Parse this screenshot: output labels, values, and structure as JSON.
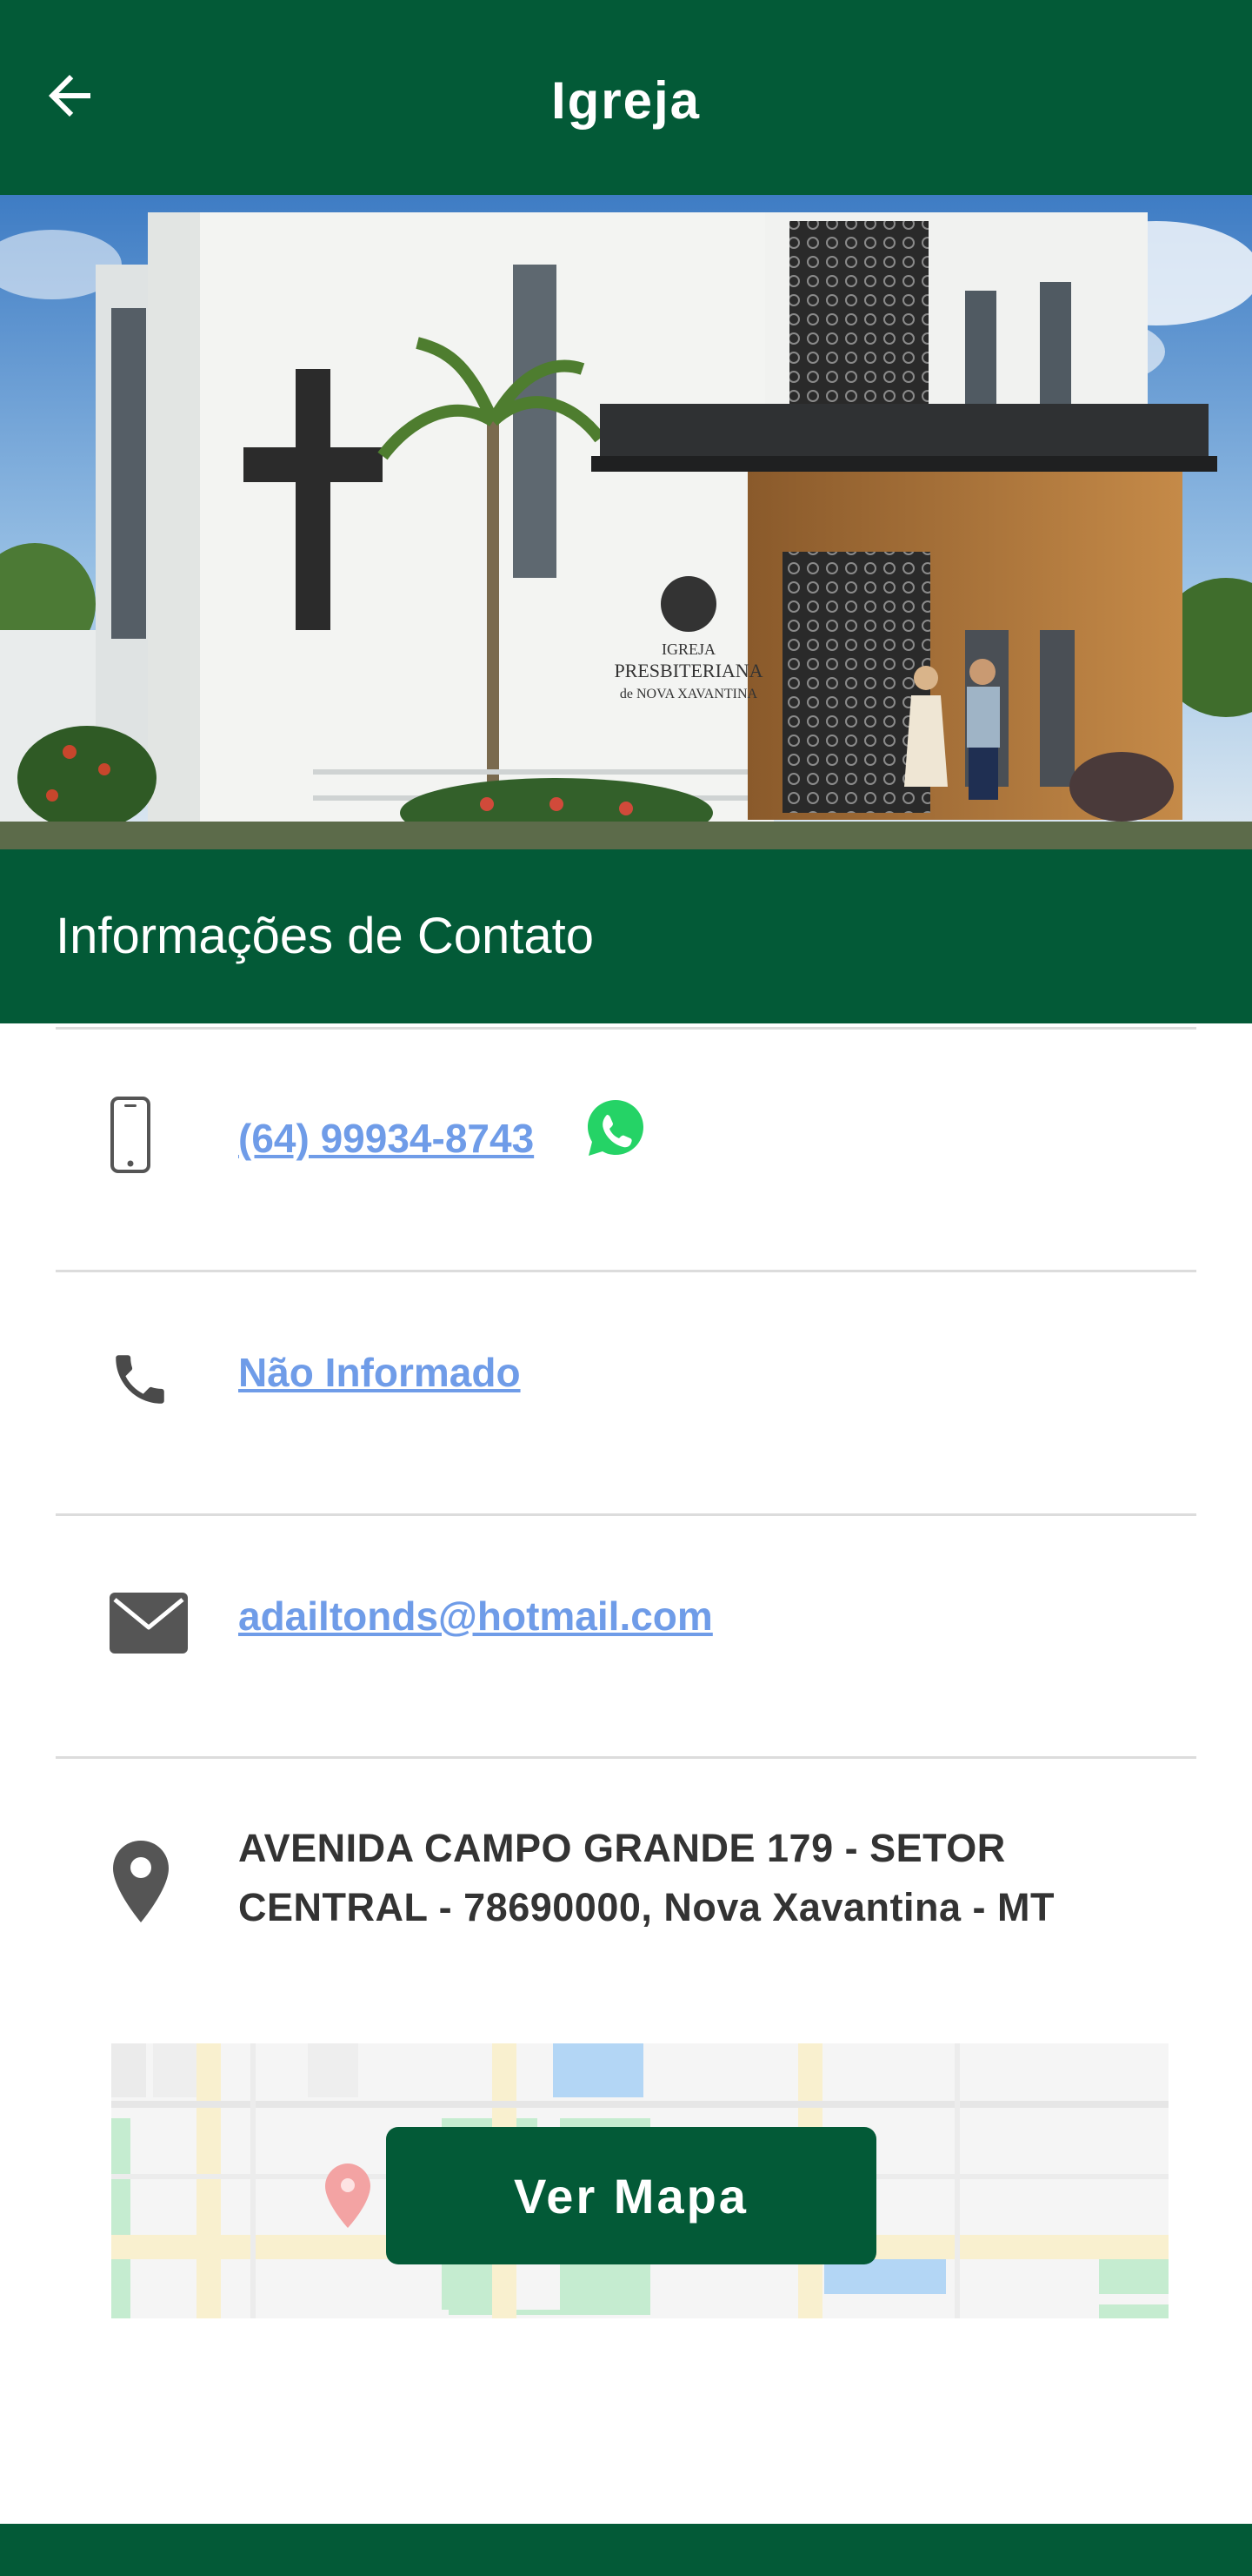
{
  "appbar": {
    "title": "Igreja",
    "back_icon": "arrow-left-icon"
  },
  "hero": {
    "sign_line1": "IGREJA",
    "sign_line2": "PRESBITERIANA",
    "sign_line3": "de NOVA XAVANTINA"
  },
  "contact": {
    "section_title": "Informações de Contato",
    "mobile": {
      "icon": "smartphone-icon",
      "value": "(64) 99934-8743",
      "whatsapp_icon": "whatsapp-icon"
    },
    "phone": {
      "icon": "phone-icon",
      "value": "Não Informado"
    },
    "email": {
      "icon": "mail-icon",
      "value": "adailtonds@hotmail.com"
    },
    "address": {
      "icon": "location-pin-icon",
      "value": "AVENIDA CAMPO GRANDE 179 - SETOR CENTRAL - 78690000, Nova Xavantina - MT"
    }
  },
  "map": {
    "button_label": "Ver Mapa",
    "pin_icon": "map-pin-icon"
  },
  "colors": {
    "primary": "#035a37",
    "link": "#6f9ce8",
    "text": "#333333",
    "divider": "#dcdcdc",
    "whatsapp": "#25d366"
  }
}
